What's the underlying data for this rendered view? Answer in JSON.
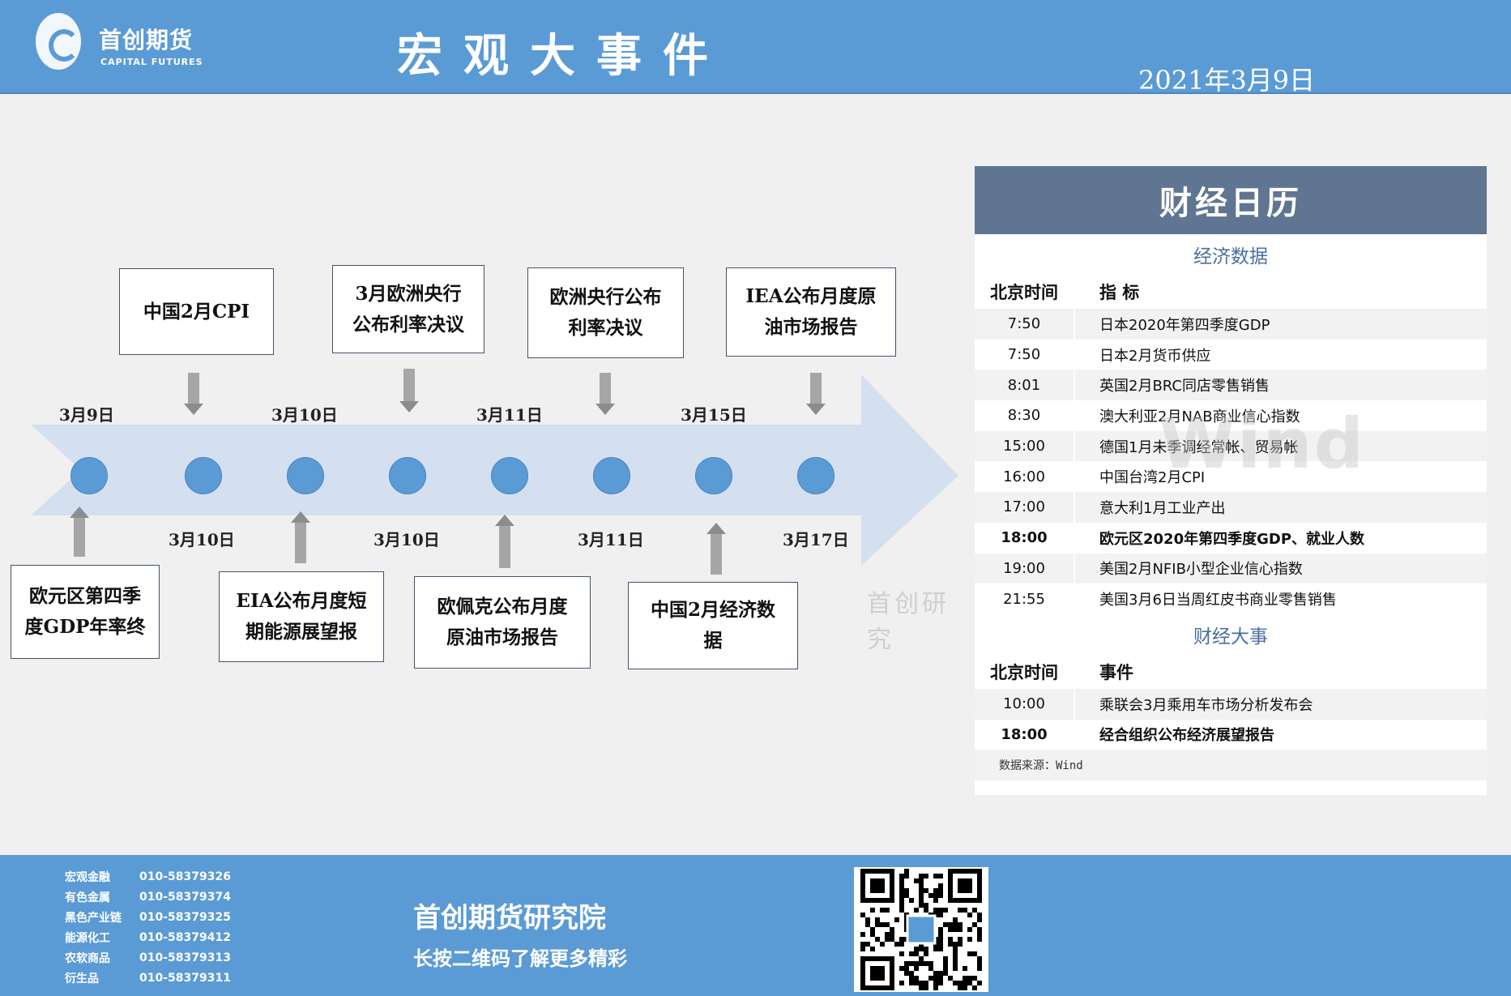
{
  "header": {
    "logo_cn": "首创期货",
    "logo_en": "CAPITAL FUTURES",
    "title": "宏观大事件",
    "date": "2021年3月9日"
  },
  "timeline": {
    "top_labels": [
      "3月9日",
      "3月10日",
      "3月11日",
      "3月15日"
    ],
    "bottom_labels": [
      "3月10日",
      "3月10日",
      "3月11日",
      "3月17日"
    ],
    "top_events": [
      {
        "line1": "中国2月CPI",
        "line2": ""
      },
      {
        "line1": "3月欧洲央行",
        "line2": "公布利率决议"
      },
      {
        "line1": "欧洲央行公布",
        "line2": "利率决议"
      },
      {
        "line1": "IEA公布月度原",
        "line2": "油市场报告"
      }
    ],
    "bottom_events": [
      {
        "line1": "欧元区第四季",
        "line2": "度GDP年率终"
      },
      {
        "line1": "EIA公布月度短",
        "line2": "期能源展望报"
      },
      {
        "line1": "欧佩克公布月度",
        "line2": "原油市场报告"
      },
      {
        "line1": "中国2月经济数",
        "line2": "据"
      }
    ],
    "watermark": "首创研究"
  },
  "calendar": {
    "title": "财经日历",
    "econ_title": "经济数据",
    "col_time": "北京时间",
    "col_indicator": "指  标",
    "econ_rows": [
      {
        "time": "7:50",
        "event": "日本2020年第四季度GDP",
        "bold": false
      },
      {
        "time": "7:50",
        "event": "日本2月货币供应",
        "bold": false
      },
      {
        "time": "8:01",
        "event": "英国2月BRC同店零售销售",
        "bold": false
      },
      {
        "time": "8:30",
        "event": "澳大利亚2月NAB商业信心指数",
        "bold": false
      },
      {
        "time": "15:00",
        "event": "德国1月未季调经常帐、贸易帐",
        "bold": false
      },
      {
        "time": "16:00",
        "event": "中国台湾2月CPI",
        "bold": false
      },
      {
        "time": "17:00",
        "event": "意大利1月工业产出",
        "bold": false
      },
      {
        "time": "18:00",
        "event": "欧元区2020年第四季度GDP、就业人数",
        "bold": true
      },
      {
        "time": "19:00",
        "event": "美国2月NFIB小型企业信心指数",
        "bold": false
      },
      {
        "time": "21:55",
        "event": "美国3月6日当周红皮书商业零售销售",
        "bold": false
      }
    ],
    "fin_title": "财经大事",
    "col_event": "事件",
    "fin_rows": [
      {
        "time": "10:00",
        "event": "乘联会3月乘用车市场分析发布会",
        "bold": false
      },
      {
        "time": "18:00",
        "event": "经合组织公布经济展望报告",
        "bold": true
      }
    ],
    "source": "数据来源：Wind",
    "watermark": "Wind"
  },
  "footer": {
    "contacts": [
      {
        "dept": "宏观金融",
        "phone": "010-58379326"
      },
      {
        "dept": "有色金属",
        "phone": "010-58379374"
      },
      {
        "dept": "黑色产业链",
        "phone": "010-58379325"
      },
      {
        "dept": "能源化工",
        "phone": "010-58379412"
      },
      {
        "dept": "农软商品",
        "phone": "010-58379313"
      },
      {
        "dept": "衍生品",
        "phone": "010-58379311"
      }
    ],
    "institute": "首创期货研究院",
    "slogan": "长按二维码了解更多精彩"
  }
}
